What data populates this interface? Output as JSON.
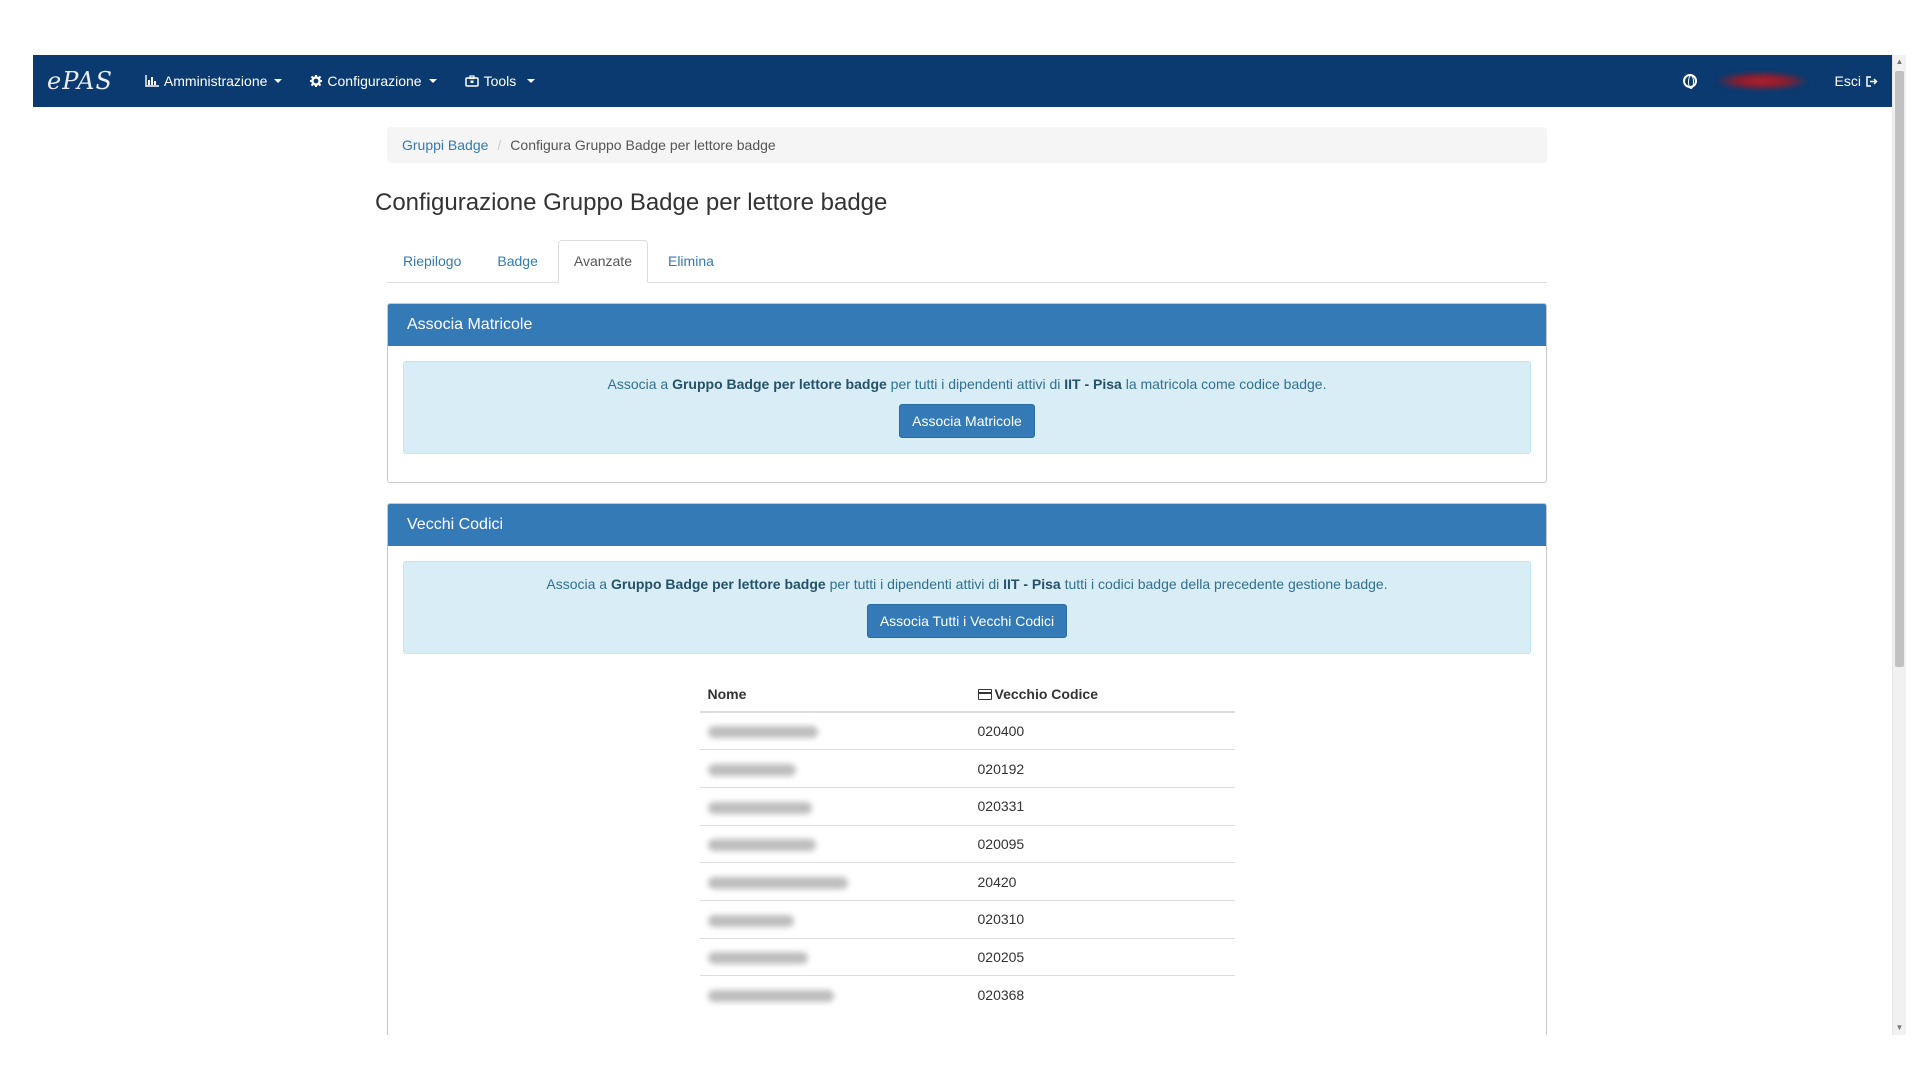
{
  "navbar": {
    "brand": "ePAS",
    "menus": [
      {
        "label": "Amministrazione",
        "icon": "bar-chart-icon"
      },
      {
        "label": "Configurazione",
        "icon": "gear-icon"
      },
      {
        "label": "Tools",
        "icon": "toolbox-icon"
      }
    ],
    "logout_label": "Esci"
  },
  "breadcrumb": {
    "link": "Gruppi Badge",
    "current": "Configura Gruppo Badge per lettore badge"
  },
  "page_title": "Configurazione Gruppo Badge per lettore badge",
  "tabs": [
    {
      "label": "Riepilogo",
      "active": false
    },
    {
      "label": "Badge",
      "active": false
    },
    {
      "label": "Avanzate",
      "active": true
    },
    {
      "label": "Elimina",
      "active": false
    }
  ],
  "panel_matricole": {
    "title": "Associa Matricole",
    "text_prefix": "Associa a ",
    "group": "Gruppo Badge per lettore badge",
    "text_mid": " per tutti i dipendenti attivi di ",
    "office": "IIT - Pisa",
    "text_suffix": " la matricola come codice badge.",
    "button": "Associa Matricole"
  },
  "panel_vecchi": {
    "title": "Vecchi Codici",
    "text_prefix": "Associa a ",
    "group": "Gruppo Badge per lettore badge",
    "text_mid": " per tutti i dipendenti attivi di ",
    "office": "IIT - Pisa",
    "text_suffix": " tutti i codici badge della precedente gestione badge.",
    "button": "Associa Tutti i Vecchi Codici",
    "table": {
      "headers": [
        "Nome",
        "Vecchio Codice"
      ],
      "rows": [
        {
          "code": "020400"
        },
        {
          "code": "020192"
        },
        {
          "code": "020331"
        },
        {
          "code": "020095"
        },
        {
          "code": "20420"
        },
        {
          "code": "020310"
        },
        {
          "code": "020205"
        },
        {
          "code": "020368"
        }
      ]
    }
  }
}
